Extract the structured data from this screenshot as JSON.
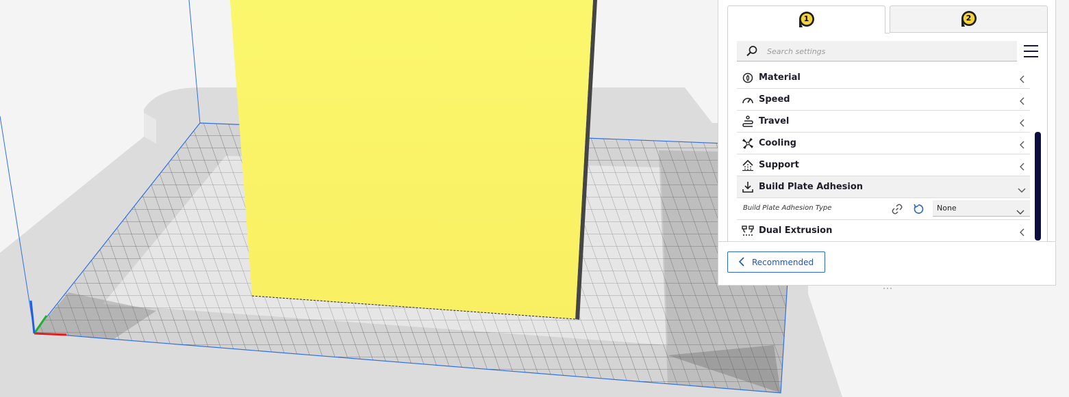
{
  "viewport": {
    "colors": {
      "model_front": "#fbf56a",
      "model_side": "#4a4a4a",
      "bed_outline": "#2f6fe0",
      "axis_x": "#e02020",
      "axis_y": "#20b030",
      "axis_z": "#2060e0"
    }
  },
  "extruder_tabs": [
    {
      "label": "1",
      "active": true
    },
    {
      "label": "2",
      "active": false
    }
  ],
  "search": {
    "placeholder": "Search settings"
  },
  "categories": [
    {
      "label": "Material",
      "icon": "material-icon",
      "expanded": false
    },
    {
      "label": "Speed",
      "icon": "speed-icon",
      "expanded": false
    },
    {
      "label": "Travel",
      "icon": "travel-icon",
      "expanded": false
    },
    {
      "label": "Cooling",
      "icon": "cooling-fan-icon",
      "expanded": false
    },
    {
      "label": "Support",
      "icon": "support-icon",
      "expanded": false
    },
    {
      "label": "Build Plate Adhesion",
      "icon": "build-plate-adhesion-icon",
      "expanded": true
    },
    {
      "label": "Dual Extrusion",
      "icon": "dual-extrusion-icon",
      "expanded": false
    }
  ],
  "setting": {
    "label": "Build Plate Adhesion Type",
    "value": "None"
  },
  "recommended_button": {
    "label": "Recommended"
  },
  "accent_color": "#2a6ad6",
  "scrollbar_color": "#0a0d3d"
}
